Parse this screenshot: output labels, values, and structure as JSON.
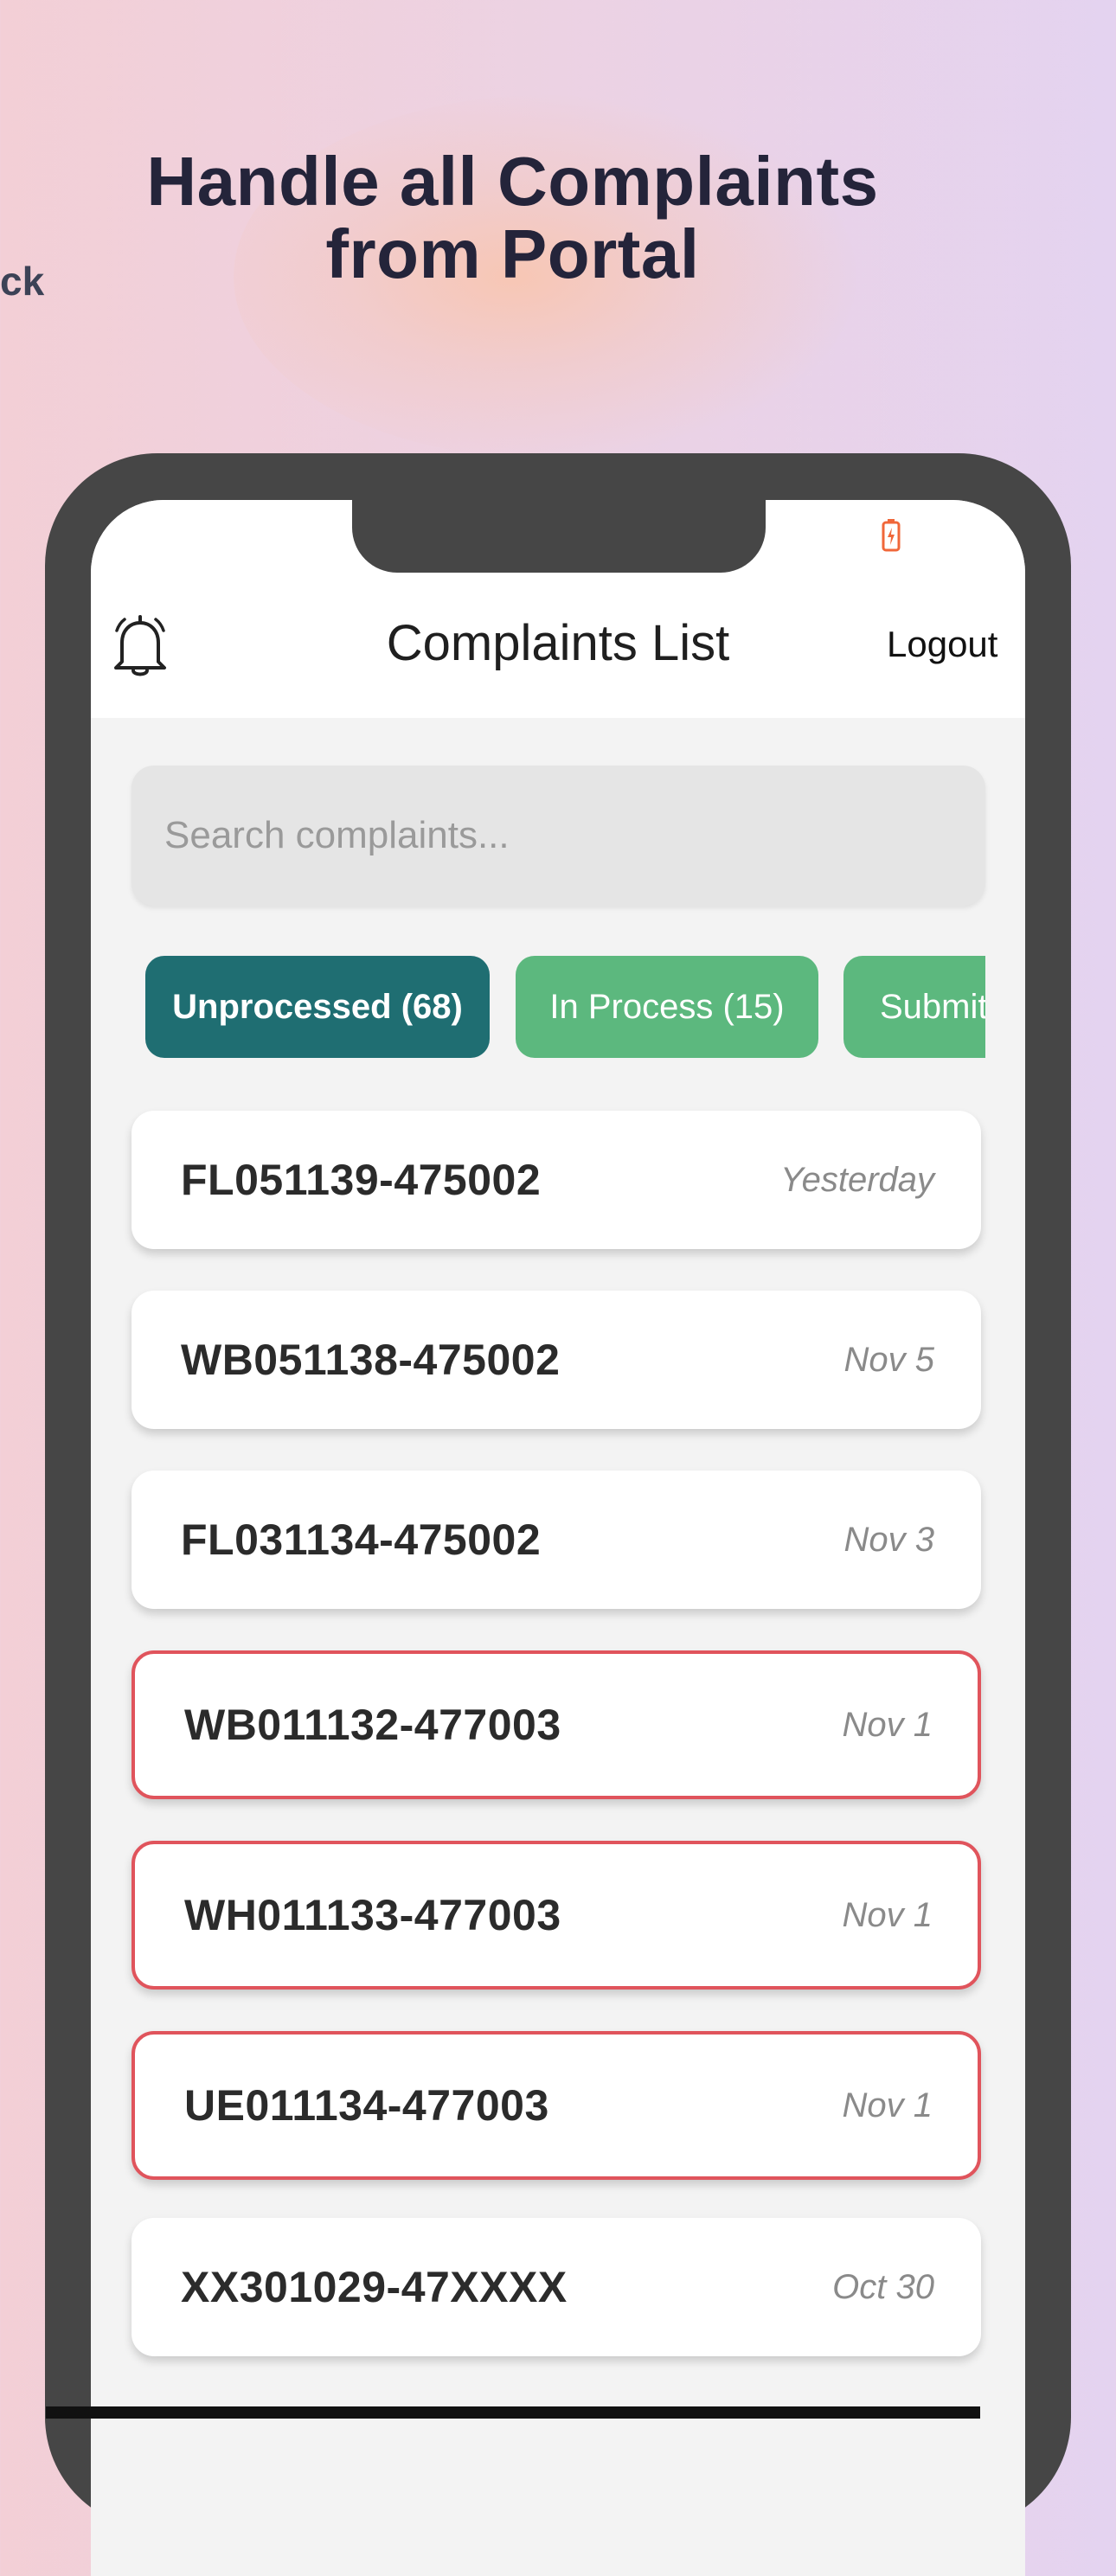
{
  "promo": {
    "headline_line1": "Handle all Complaints",
    "headline_line2": "from Portal",
    "side_text": "ck"
  },
  "app": {
    "title": "Complaints List",
    "logout_label": "Logout",
    "search_placeholder": "Search complaints...",
    "icons": {
      "notifications": "bell-icon",
      "battery": "battery-icon"
    }
  },
  "tabs": [
    {
      "label": "Unprocessed (68)",
      "active": true
    },
    {
      "label": "In Process (15)",
      "active": false
    },
    {
      "label": "Submit",
      "active": false
    }
  ],
  "complaints": [
    {
      "id": "FL051139-475002",
      "date": "Yesterday",
      "flagged": false
    },
    {
      "id": "WB051138-475002",
      "date": "Nov 5",
      "flagged": false
    },
    {
      "id": "FL031134-475002",
      "date": "Nov 3",
      "flagged": false
    },
    {
      "id": "WB011132-477003",
      "date": "Nov 1",
      "flagged": true
    },
    {
      "id": "WH011133-477003",
      "date": "Nov 1",
      "flagged": true
    },
    {
      "id": "UE011134-477003",
      "date": "Nov 1",
      "flagged": true
    },
    {
      "id": "XX301029-47XXXX",
      "date": "Oct 30",
      "flagged": false
    }
  ],
  "colors": {
    "active_tab": "#1f6e72",
    "inactive_tab": "#5cb87e",
    "flag_border": "#e0545c",
    "battery": "#f0673a",
    "device_frame": "#464646"
  }
}
